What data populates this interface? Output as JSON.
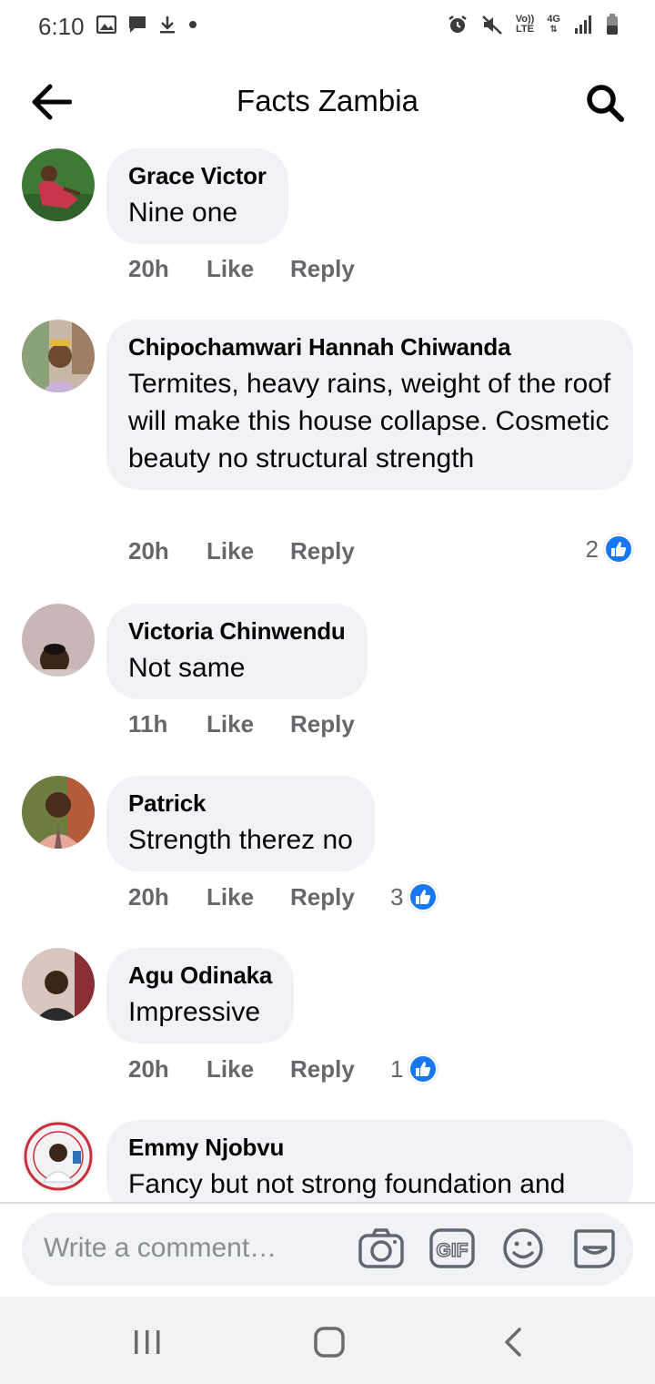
{
  "status_bar": {
    "time": "6:10",
    "left_icons": [
      "image-icon",
      "chat-icon",
      "download-icon",
      "dot-icon"
    ],
    "right_icons": [
      "alarm-icon",
      "mute-icon",
      "volte-icon",
      "4g-icon",
      "signal-icon",
      "battery-icon"
    ],
    "volte_label_top": "Vo))",
    "volte_label_bottom": "LTE",
    "network_label": "4G"
  },
  "header": {
    "title": "Facts Zambia",
    "back_icon": "back-arrow-icon",
    "search_icon": "search-icon"
  },
  "actions": {
    "like_label": "Like",
    "reply_label": "Reply"
  },
  "comments": [
    {
      "author": "Grace Victor",
      "text": "Nine one",
      "time": "20h",
      "reactions": ""
    },
    {
      "author": "Chipochamwari Hannah Chiwanda",
      "text": "Termites, heavy rains, weight of the roof will make this house collapse. Cosmetic beauty no  structural strength",
      "time": "20h",
      "reactions": "2"
    },
    {
      "author": "Victoria Chinwendu",
      "text": "Not same",
      "time": "11h",
      "reactions": ""
    },
    {
      "author": "Patrick",
      "text": "Strength therez no",
      "time": "20h",
      "reactions": "3"
    },
    {
      "author": "Agu Odinaka",
      "text": "Impressive",
      "time": "20h",
      "reactions": "1"
    },
    {
      "author": "Emmy Njobvu",
      "text": "Fancy but not strong foundation and",
      "time": "",
      "reactions": ""
    }
  ],
  "composer": {
    "placeholder": "Write a comment…",
    "icons": [
      "camera-icon",
      "gif-icon",
      "emoji-icon",
      "sticker-icon"
    ],
    "gif_label": "GIF"
  },
  "colors": {
    "bubble": "#f0f2f5",
    "meta_text": "#65676b",
    "like_blue": "#1877f2"
  }
}
